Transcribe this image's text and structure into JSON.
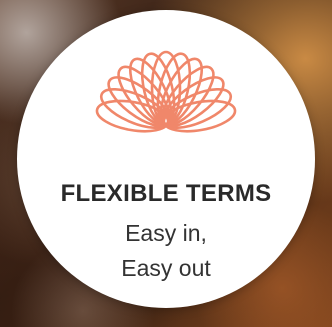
{
  "card": {
    "title": "FLEXIBLE TERMS",
    "line1": "Easy in,",
    "line2": "Easy out",
    "icon": "coil-spring-icon",
    "accent_color": "#f0876a"
  }
}
